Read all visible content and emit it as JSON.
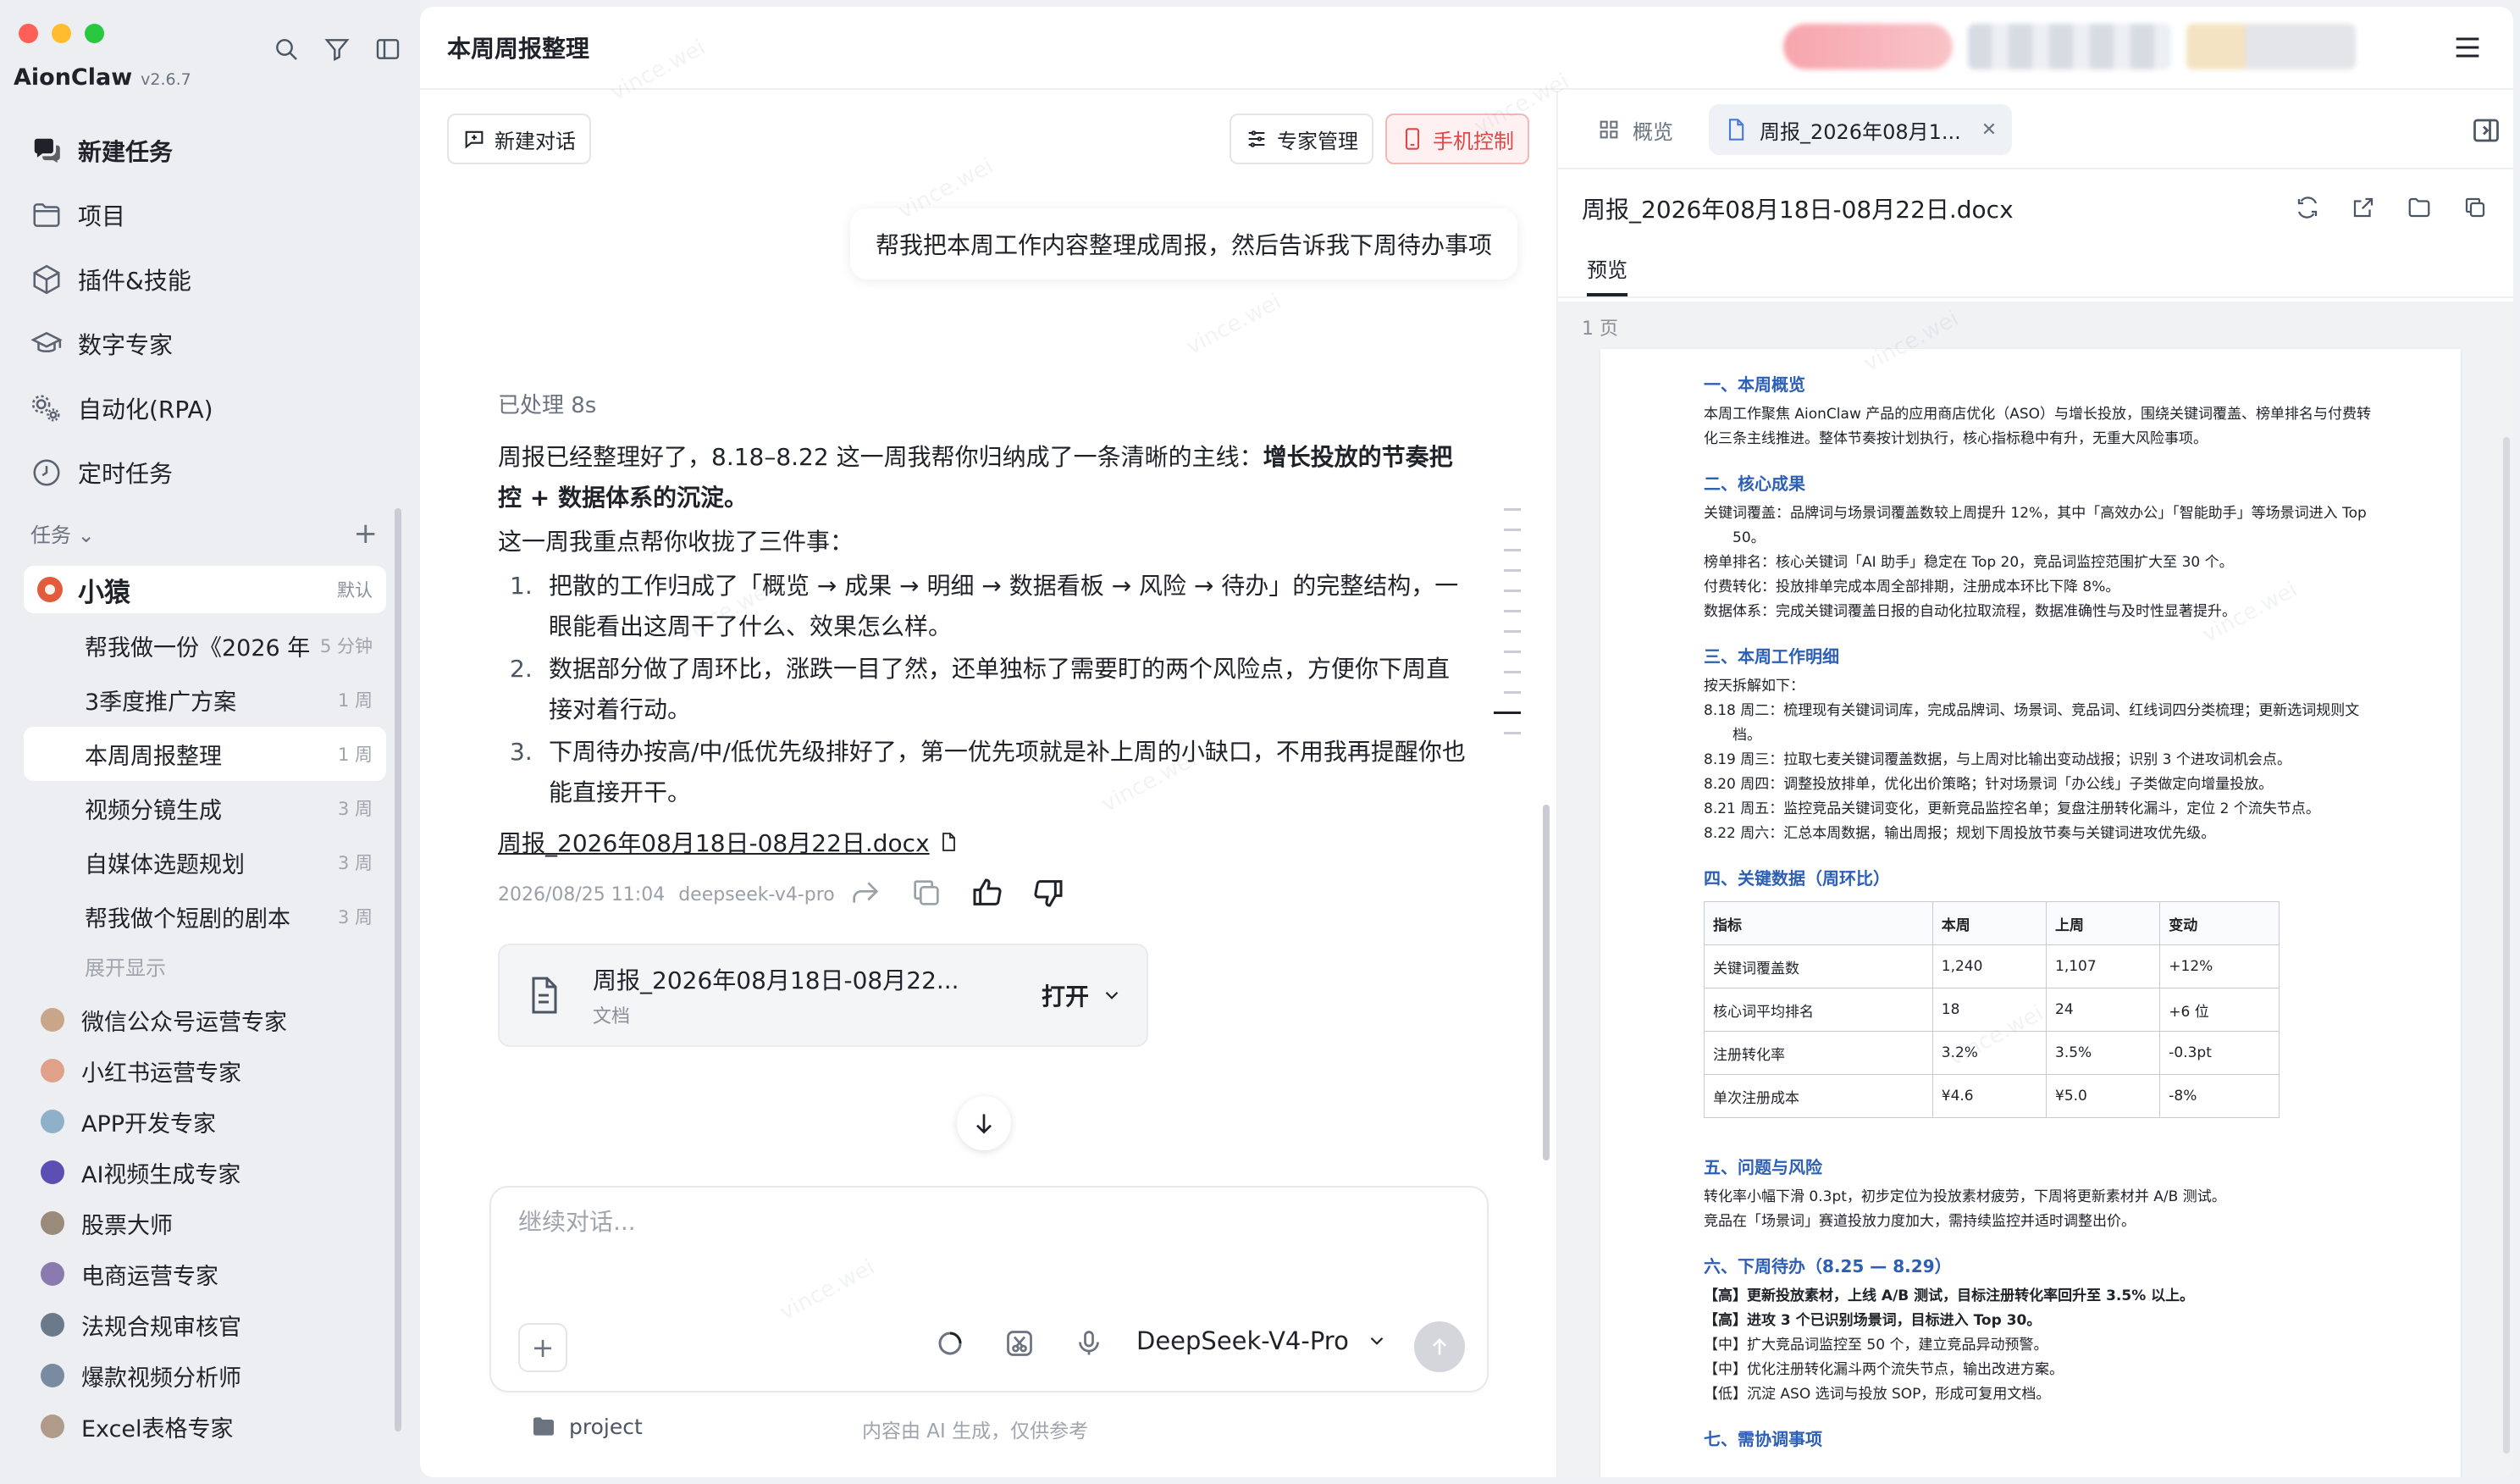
{
  "app": {
    "name": "AionClaw",
    "version": "v2.6.7"
  },
  "sidebar": {
    "nav": [
      {
        "label": "新建任务",
        "icon": "chat-bubbles-icon"
      },
      {
        "label": "项目",
        "icon": "folder-icon"
      },
      {
        "label": "插件&技能",
        "icon": "cube-icon"
      },
      {
        "label": "数字专家",
        "icon": "graduation-cap-icon"
      },
      {
        "label": "自动化(RPA)",
        "icon": "gears-icon"
      },
      {
        "label": "定时任务",
        "icon": "clock-icon"
      }
    ],
    "tasks_header": "任务",
    "agent": {
      "name": "小猿",
      "tag": "默认"
    },
    "tasks": [
      {
        "title": "帮我做一份《2026 年",
        "time": "5 分钟"
      },
      {
        "title": "3季度推广方案",
        "time": "1 周"
      },
      {
        "title": "本周周报整理",
        "time": "1 周"
      },
      {
        "title": "视频分镜生成",
        "time": "3 周"
      },
      {
        "title": "自媒体选题规划",
        "time": "3 周"
      },
      {
        "title": "帮我做个短剧的剧本",
        "time": "3 周"
      }
    ],
    "expand_label": "展开显示",
    "experts": [
      {
        "name": "微信公众号运营专家",
        "color": "#c9a58a"
      },
      {
        "name": "小红书运营专家",
        "color": "#e0a08a"
      },
      {
        "name": "APP开发专家",
        "color": "#8fb0c9"
      },
      {
        "name": "AI视频生成专家",
        "color": "#5b4fb3"
      },
      {
        "name": "股票大师",
        "color": "#9a8a7a"
      },
      {
        "name": "电商运营专家",
        "color": "#8a7ab0"
      },
      {
        "name": "法规合规审核官",
        "color": "#6a7a8a"
      },
      {
        "name": "爆款视频分析师",
        "color": "#7a8aa0"
      },
      {
        "name": "Excel表格专家",
        "color": "#b09a8a"
      }
    ]
  },
  "header": {
    "title": "本周周报整理"
  },
  "chat": {
    "new_chat_label": "新建对话",
    "expert_manage_label": "专家管理",
    "phone_control_label": "手机控制",
    "user_message": "帮我把本周工作内容整理成周报，然后告诉我下周待办事项",
    "processed": "已处理 8s",
    "answer_intro": "周报已经整理好了，8.18–8.22 这一周我帮你归纳成了一条清晰的主线：",
    "answer_bold": "增长投放的节奏把控 + 数据体系的沉淀。",
    "answer_lead": "这一周我重点帮你收拢了三件事：",
    "answer_items": [
      "把散的工作归成了「概览 → 成果 → 明细 → 数据看板 → 风险 → 待办」的完整结构，一眼能看出这周干了什么、效果怎么样。",
      "数据部分做了周环比，涨跌一目了然，还单独标了需要盯的两个风险点，方便你下周直接对着行动。",
      "下周待办按高/中/低优先级排好了，第一优先项就是补上周的小缺口，不用我再提醒你也能直接开干。"
    ],
    "doc_link": "周报_2026年08月18日-08月22日.docx",
    "meta_time": "2026/08/25 11:04",
    "meta_model": "deepseek-v4-pro",
    "file_card": {
      "name": "周报_2026年08月18日-08月22...",
      "type": "文档",
      "open_label": "打开"
    },
    "composer_placeholder": "继续对话...",
    "model": "DeepSeek-V4-Pro",
    "project_label": "project",
    "disclaimer": "内容由 AI 生成，仅供参考"
  },
  "preview": {
    "tab_overview": "概览",
    "tab_doc": "周报_2026年08月1...",
    "title": "周报_2026年08月18日-08月22日.docx",
    "subtab": "预览",
    "page_count": "1 页",
    "doc": {
      "s1": "一、本周概览",
      "s1_p": "本周工作聚焦 AionClaw 产品的应用商店优化（ASO）与增长投放，围绕关键词覆盖、榜单排名与付费转化三条主线推进。整体节奏按计划执行，核心指标稳中有升，无重大风险事项。",
      "s2": "二、核心成果",
      "s2_p": [
        "关键词覆盖：品牌词与场景词覆盖数较上周提升 12%，其中「高效办公」「智能助手」等场景词进入 Top 50。",
        "榜单排名：核心关键词「AI 助手」稳定在 Top 20，竞品词监控范围扩大至 30 个。",
        "付费转化：投放排单完成本周全部排期，注册成本环比下降 8%。",
        "数据体系：完成关键词覆盖日报的自动化拉取流程，数据准确性与及时性显著提升。"
      ],
      "s3": "三、本周工作明细",
      "s3_intro": "按天拆解如下：",
      "s3_p": [
        "8.18 周二：梳理现有关键词词库，完成品牌词、场景词、竞品词、红线词四分类梳理；更新选词规则文档。",
        "8.19 周三：拉取七麦关键词覆盖数据，与上周对比输出变动战报；识别 3 个进攻词机会点。",
        "8.20 周四：调整投放排单，优化出价策略；针对场景词「办公线」子类做定向增量投放。",
        "8.21 周五：监控竞品关键词变化，更新竞品监控名单；复盘注册转化漏斗，定位 2 个流失节点。",
        "8.22 周六：汇总本周数据，输出周报；规划下周投放节奏与关键词进攻优先级。"
      ],
      "s4": "四、关键数据（周环比）",
      "table": [
        [
          "指标",
          "本周",
          "上周",
          "变动"
        ],
        [
          "关键词覆盖数",
          "1,240",
          "1,107",
          "+12%"
        ],
        [
          "核心词平均排名",
          "18",
          "24",
          "+6 位"
        ],
        [
          "注册转化率",
          "3.2%",
          "3.5%",
          "-0.3pt"
        ],
        [
          "单次注册成本",
          "¥4.6",
          "¥5.0",
          "-8%"
        ]
      ],
      "s5": "五、问题与风险",
      "s5_p": [
        "转化率小幅下滑 0.3pt，初步定位为投放素材疲劳，下周将更新素材并 A/B 测试。",
        "竞品在「场景词」赛道投放力度加大，需持续监控并适时调整出价。"
      ],
      "s6": "六、下周待办（8.25 — 8.29）",
      "s6_p": [
        "【高】更新投放素材，上线 A/B 测试，目标注册转化率回升至 3.5% 以上。",
        "【高】进攻 3 个已识别场景词，目标进入 Top 30。",
        "【中】扩大竞品词监控至 50 个，建立竞品异动预警。",
        "【中】优化注册转化漏斗两个流失节点，输出改进方案。",
        "【低】沉淀 ASO 选词与投放 SOP，形成可复用文档。"
      ],
      "s7": "七、需协调事项"
    }
  },
  "watermark": "vince.wei"
}
